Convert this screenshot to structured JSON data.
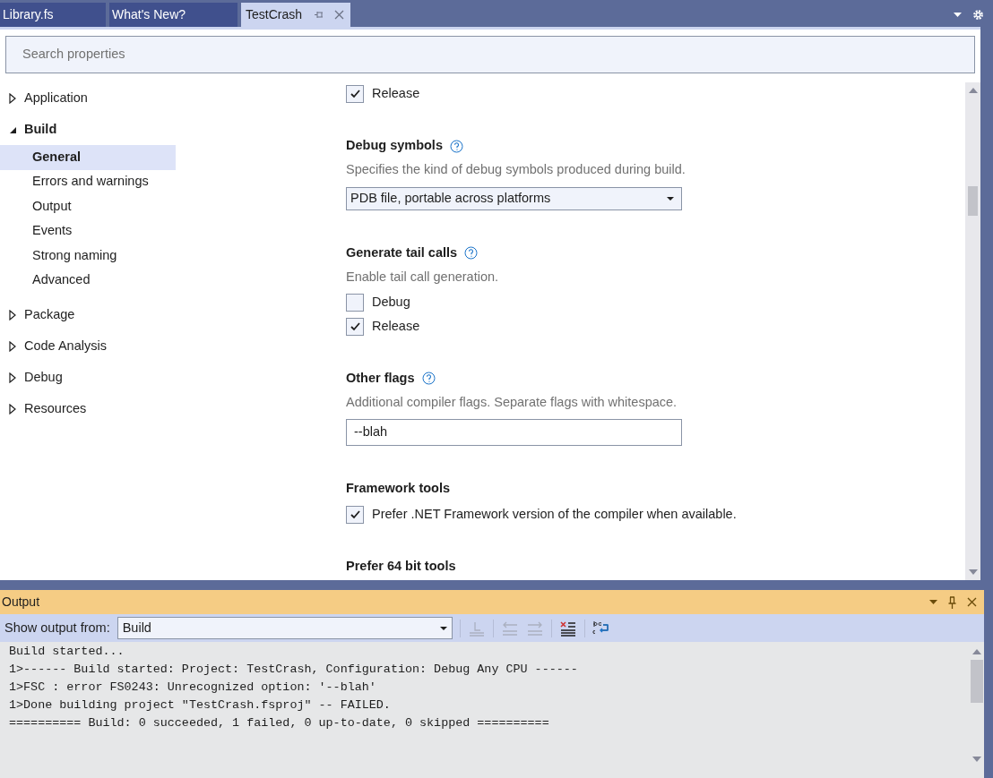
{
  "tabs": [
    {
      "label": "Library.fs",
      "selected": false
    },
    {
      "label": "What's New?",
      "selected": false
    },
    {
      "label": "TestCrash",
      "selected": true
    }
  ],
  "search": {
    "placeholder": "Search properties"
  },
  "sidebar": {
    "items": [
      {
        "label": "Application",
        "expanded": false,
        "selected": false
      },
      {
        "label": "Build",
        "expanded": true,
        "selected": false,
        "children": [
          {
            "label": "General",
            "selected": true
          },
          {
            "label": "Errors and warnings",
            "selected": false
          },
          {
            "label": "Output",
            "selected": false
          },
          {
            "label": "Events",
            "selected": false
          },
          {
            "label": "Strong naming",
            "selected": false
          },
          {
            "label": "Advanced",
            "selected": false
          }
        ]
      },
      {
        "label": "Package",
        "expanded": false,
        "selected": false
      },
      {
        "label": "Code Analysis",
        "expanded": false,
        "selected": false
      },
      {
        "label": "Debug",
        "expanded": false,
        "selected": false
      },
      {
        "label": "Resources",
        "expanded": false,
        "selected": false
      }
    ]
  },
  "settings": [
    {
      "kind": "checkboxes",
      "options": [
        {
          "label": "Release",
          "checked": true
        }
      ]
    },
    {
      "kind": "dropdown",
      "title": "Debug symbols",
      "help": true,
      "description": "Specifies the kind of debug symbols produced during build.",
      "value": "PDB file, portable across platforms"
    },
    {
      "kind": "checkboxes",
      "title": "Generate tail calls",
      "help": true,
      "description": "Enable tail call generation.",
      "options": [
        {
          "label": "Debug",
          "checked": false
        },
        {
          "label": "Release",
          "checked": true
        }
      ]
    },
    {
      "kind": "text",
      "title": "Other flags",
      "help": true,
      "description": "Additional compiler flags. Separate flags with whitespace.",
      "value": "--blah"
    },
    {
      "kind": "checkboxes",
      "title": "Framework tools",
      "help": false,
      "options": [
        {
          "label": "Prefer .NET Framework version of the compiler when available.",
          "checked": true
        }
      ]
    },
    {
      "kind": "heading",
      "title": "Prefer 64 bit tools",
      "help": false
    }
  ],
  "output": {
    "title": "Output",
    "source_label": "Show output from:",
    "source": "Build",
    "lines": [
      "Build started...",
      "1>------ Build started: Project: TestCrash, Configuration: Debug Any CPU ------",
      "1>FSC : error FS0243: Unrecognized option: '--blah'",
      "1>Done building project \"TestCrash.fsproj\" -- FAILED.",
      "========== Build: 0 succeeded, 1 failed, 0 up-to-date, 0 skipped =========="
    ]
  }
}
